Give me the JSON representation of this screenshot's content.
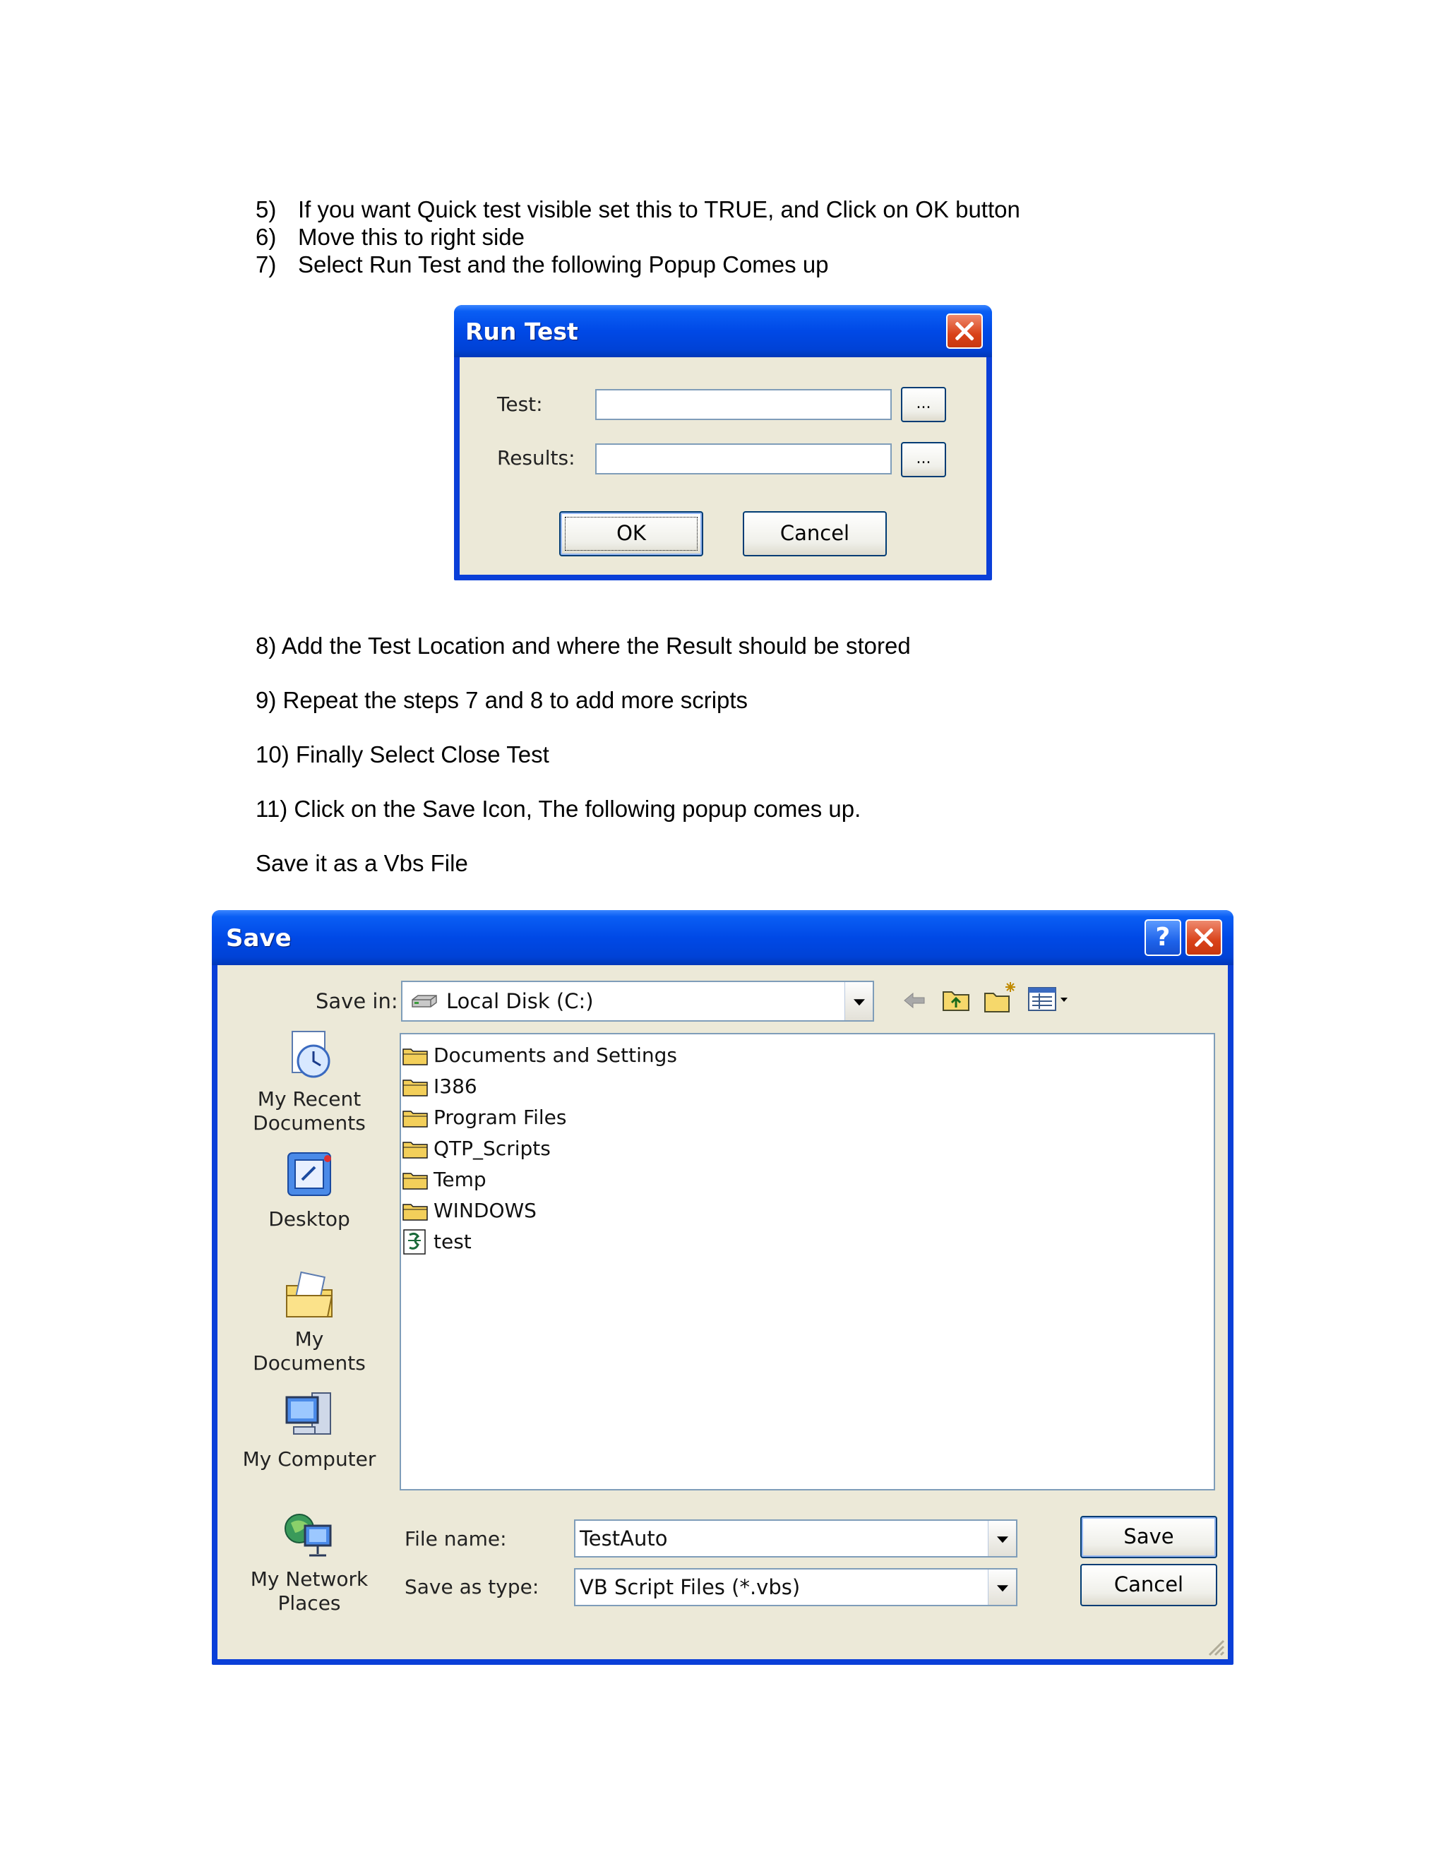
{
  "steps_top": [
    {
      "num": "5)",
      "text": "If you want Quick test visible set this to TRUE, and Click on OK button"
    },
    {
      "num": "6)",
      "text": "Move this to right side"
    },
    {
      "num": "7)",
      "text": "Select Run Test and the following Popup Comes up"
    }
  ],
  "run_test": {
    "title": "Run Test",
    "test_label": "Test:",
    "test_value": "",
    "results_label": "Results:",
    "results_value": "",
    "browse_label": "...",
    "ok_label": "OK",
    "cancel_label": "Cancel"
  },
  "steps_middle": [
    "8) Add the Test Location and where the Result should be stored",
    "9) Repeat the steps 7 and 8 to add more scripts",
    "10) Finally Select Close Test",
    "11) Click on the Save Icon, The following popup comes up.",
    "Save it as a Vbs File"
  ],
  "save_dialog": {
    "title": "Save",
    "help_label": "?",
    "save_in_label": "Save in:",
    "save_in_value": "Local Disk (C:)",
    "places": [
      {
        "label": "My Recent Documents",
        "icon": "my-recent-documents-icon"
      },
      {
        "label": "Desktop",
        "icon": "desktop-icon"
      },
      {
        "label": "My Documents",
        "icon": "my-documents-icon"
      },
      {
        "label": "My Computer",
        "icon": "my-computer-icon"
      },
      {
        "label": "My Network Places",
        "icon": "my-network-places-icon"
      }
    ],
    "files": [
      {
        "name": "Documents and Settings",
        "type": "folder"
      },
      {
        "name": "I386",
        "type": "folder"
      },
      {
        "name": "Program Files",
        "type": "folder"
      },
      {
        "name": "QTP_Scripts",
        "type": "folder"
      },
      {
        "name": "Temp",
        "type": "folder"
      },
      {
        "name": "WINDOWS",
        "type": "folder"
      },
      {
        "name": "test",
        "type": "script"
      }
    ],
    "file_name_label": "File name:",
    "file_name_value": "TestAuto",
    "save_as_type_label": "Save as type:",
    "save_as_type_value": "VB Script Files (*.vbs)",
    "save_label": "Save",
    "cancel_label": "Cancel"
  }
}
